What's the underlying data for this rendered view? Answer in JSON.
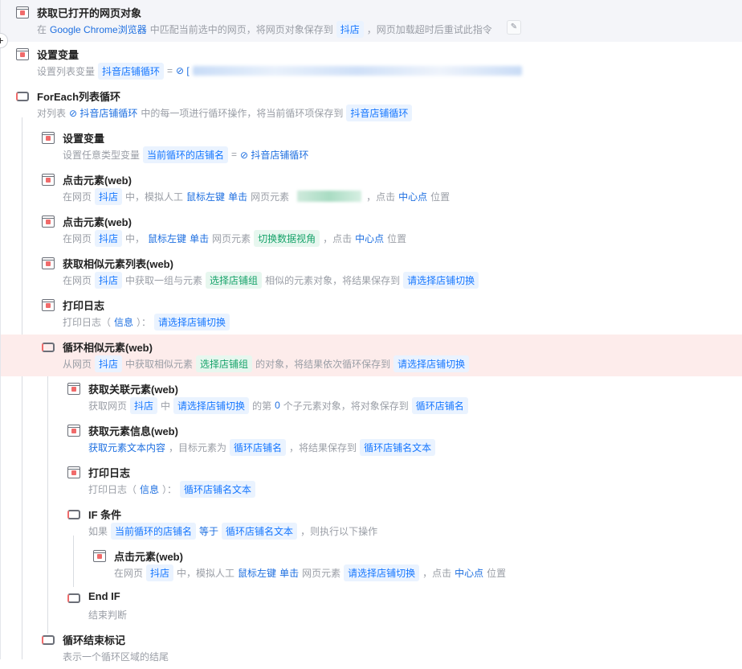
{
  "steps": [
    {
      "level": 0,
      "icon": "browser-icon",
      "title": "获取已打开的网页对象",
      "state": "selected",
      "desc": [
        {
          "t": "text",
          "v": "在"
        },
        {
          "t": "link",
          "v": "Google Chrome浏览器"
        },
        {
          "t": "text",
          "v": "中匹配当前选中的网页，将网页对象保存到"
        },
        {
          "t": "chip",
          "v": "抖店"
        },
        {
          "t": "text",
          "v": "，网页加载超时后重试此指令"
        }
      ]
    },
    {
      "level": 0,
      "icon": "variable-icon",
      "title": "设置变量",
      "desc": [
        {
          "t": "text",
          "v": "设置列表变量"
        },
        {
          "t": "chip",
          "v": "抖音店铺循环"
        },
        {
          "t": "text",
          "v": "="
        },
        {
          "t": "link",
          "v": "⊘ ["
        },
        {
          "t": "blur"
        }
      ]
    },
    {
      "level": 0,
      "icon": "loop-icon",
      "title": "ForEach列表循环",
      "desc": [
        {
          "t": "text",
          "v": "对列表"
        },
        {
          "t": "link",
          "v": "⊘ 抖音店铺循环"
        },
        {
          "t": "text",
          "v": "中的每一项进行循环操作，将当前循环项保存到"
        },
        {
          "t": "chip",
          "v": "抖音店铺循环"
        }
      ]
    },
    {
      "level": 1,
      "icon": "variable-icon",
      "title": "设置变量",
      "desc": [
        {
          "t": "text",
          "v": "设置任意类型变量"
        },
        {
          "t": "chip",
          "v": "当前循环的店铺名"
        },
        {
          "t": "text",
          "v": "="
        },
        {
          "t": "link",
          "v": "⊘ 抖音店铺循环"
        }
      ]
    },
    {
      "level": 1,
      "icon": "click-icon",
      "title": "点击元素(web)",
      "desc": [
        {
          "t": "text",
          "v": "在网页"
        },
        {
          "t": "chip",
          "v": "抖店"
        },
        {
          "t": "text",
          "v": "中，模拟人工"
        },
        {
          "t": "link",
          "v": "鼠标左键"
        },
        {
          "t": "link",
          "v": "单击"
        },
        {
          "t": "text",
          "v": "网页元素"
        },
        {
          "t": "gblur"
        },
        {
          "t": "text",
          "v": "，点击"
        },
        {
          "t": "link",
          "v": "中心点"
        },
        {
          "t": "text",
          "v": "位置"
        }
      ]
    },
    {
      "level": 1,
      "icon": "click-icon",
      "title": "点击元素(web)",
      "desc": [
        {
          "t": "text",
          "v": "在网页"
        },
        {
          "t": "chip",
          "v": "抖店"
        },
        {
          "t": "text",
          "v": "中，"
        },
        {
          "t": "link",
          "v": "鼠标左键"
        },
        {
          "t": "link",
          "v": "单击"
        },
        {
          "t": "text",
          "v": "网页元素"
        },
        {
          "t": "gchip",
          "v": "切换数据视角"
        },
        {
          "t": "text",
          "v": "，点击"
        },
        {
          "t": "link",
          "v": "中心点"
        },
        {
          "t": "text",
          "v": "位置"
        }
      ]
    },
    {
      "level": 1,
      "icon": "element-list-icon",
      "title": "获取相似元素列表(web)",
      "desc": [
        {
          "t": "text",
          "v": "在网页"
        },
        {
          "t": "chip",
          "v": "抖店"
        },
        {
          "t": "text",
          "v": "中获取一组与元素"
        },
        {
          "t": "gchip",
          "v": "选择店铺组"
        },
        {
          "t": "text",
          "v": "相似的元素对象，将结果保存到"
        },
        {
          "t": "chip",
          "v": "请选择店铺切换"
        }
      ]
    },
    {
      "level": 1,
      "icon": "print-icon",
      "title": "打印日志",
      "desc": [
        {
          "t": "text",
          "v": "打印日志（"
        },
        {
          "t": "link",
          "v": "信息"
        },
        {
          "t": "text",
          "v": "）："
        },
        {
          "t": "chip",
          "v": "请选择店铺切换"
        }
      ]
    },
    {
      "level": 1,
      "icon": "loop-icon",
      "title": "循环相似元素(web)",
      "state": "error",
      "desc": [
        {
          "t": "text",
          "v": "从网页"
        },
        {
          "t": "chip",
          "v": "抖店"
        },
        {
          "t": "text",
          "v": "中获取相似元素"
        },
        {
          "t": "gchip",
          "v": "选择店铺组"
        },
        {
          "t": "text",
          "v": "的对象，将结果依次循环保存到"
        },
        {
          "t": "chip",
          "v": "请选择店铺切换"
        }
      ]
    },
    {
      "level": 2,
      "icon": "related-element-icon",
      "title": "获取关联元素(web)",
      "desc": [
        {
          "t": "text",
          "v": "获取网页"
        },
        {
          "t": "chip",
          "v": "抖店"
        },
        {
          "t": "text",
          "v": "中"
        },
        {
          "t": "chip",
          "v": "请选择店铺切换"
        },
        {
          "t": "text",
          "v": "的第"
        },
        {
          "t": "link",
          "v": "0"
        },
        {
          "t": "text",
          "v": "个子元素对象，将对象保存到"
        },
        {
          "t": "chip",
          "v": "循环店铺名"
        }
      ]
    },
    {
      "level": 2,
      "icon": "element-info-icon",
      "title": "获取元素信息(web)",
      "desc": [
        {
          "t": "link",
          "v": "获取元素文本内容"
        },
        {
          "t": "text",
          "v": "，目标元素为"
        },
        {
          "t": "chip",
          "v": "循环店铺名"
        },
        {
          "t": "text",
          "v": "，将结果保存到"
        },
        {
          "t": "chip",
          "v": "循环店铺名文本"
        }
      ]
    },
    {
      "level": 2,
      "icon": "print-icon",
      "title": "打印日志",
      "desc": [
        {
          "t": "text",
          "v": "打印日志（"
        },
        {
          "t": "link",
          "v": "信息"
        },
        {
          "t": "text",
          "v": "）："
        },
        {
          "t": "chip",
          "v": "循环店铺名文本"
        }
      ]
    },
    {
      "level": 2,
      "icon": "if-icon",
      "title": "IF 条件",
      "desc": [
        {
          "t": "text",
          "v": "如果"
        },
        {
          "t": "chip",
          "v": "当前循环的店铺名"
        },
        {
          "t": "link",
          "v": "等于"
        },
        {
          "t": "chip",
          "v": "循环店铺名文本"
        },
        {
          "t": "text",
          "v": "，则执行以下操作"
        }
      ]
    },
    {
      "level": 3,
      "icon": "click-icon",
      "title": "点击元素(web)",
      "desc": [
        {
          "t": "text",
          "v": "在网页"
        },
        {
          "t": "chip",
          "v": "抖店"
        },
        {
          "t": "text",
          "v": "中，模拟人工"
        },
        {
          "t": "link",
          "v": "鼠标左键"
        },
        {
          "t": "link",
          "v": "单击"
        },
        {
          "t": "text",
          "v": "网页元素"
        },
        {
          "t": "chip",
          "v": "请选择店铺切换"
        },
        {
          "t": "text",
          "v": "，点击"
        },
        {
          "t": "link",
          "v": "中心点"
        },
        {
          "t": "text",
          "v": "位置"
        }
      ]
    },
    {
      "level": 2,
      "icon": "end-if-icon",
      "title": "End IF",
      "desc": [
        {
          "t": "text",
          "v": "结束判断"
        }
      ]
    },
    {
      "level": 1,
      "icon": "loop-end-icon",
      "title": "循环结束标记",
      "desc": [
        {
          "t": "text",
          "v": "表示一个循环区域的结尾"
        }
      ]
    }
  ]
}
